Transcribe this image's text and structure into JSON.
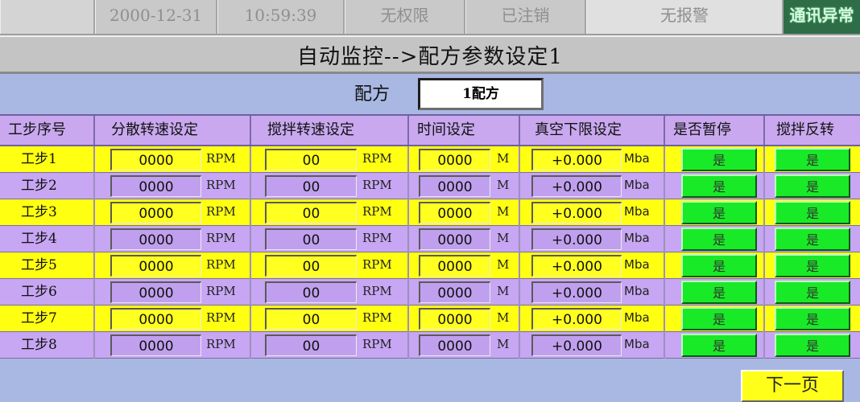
{
  "status": {
    "date": "2000-12-31",
    "time": "10:59:39",
    "permission": "无权限",
    "login": "已注销",
    "alarm": "无报警",
    "comm": "通讯异常"
  },
  "page_title": "自动监控-->配方参数设定1",
  "recipe": {
    "label": "配方",
    "value": "1配方"
  },
  "headers": [
    "工步序号",
    "分散转速设定",
    "搅拌转速设定",
    "时间设定",
    "真空下限设定",
    "是否暂停",
    "搅拌反转"
  ],
  "units": {
    "rpm": "RPM",
    "minute": "M",
    "vacuum": "Mba"
  },
  "rows": [
    {
      "step": "工步1",
      "disperse": "0000",
      "stir": "00",
      "time": "0000",
      "vacuum": "+0.000",
      "pause": "是",
      "reverse": "是"
    },
    {
      "step": "工步2",
      "disperse": "0000",
      "stir": "00",
      "time": "0000",
      "vacuum": "+0.000",
      "pause": "是",
      "reverse": "是"
    },
    {
      "step": "工步3",
      "disperse": "0000",
      "stir": "00",
      "time": "0000",
      "vacuum": "+0.000",
      "pause": "是",
      "reverse": "是"
    },
    {
      "step": "工步4",
      "disperse": "0000",
      "stir": "00",
      "time": "0000",
      "vacuum": "+0.000",
      "pause": "是",
      "reverse": "是"
    },
    {
      "step": "工步5",
      "disperse": "0000",
      "stir": "00",
      "time": "0000",
      "vacuum": "+0.000",
      "pause": "是",
      "reverse": "是"
    },
    {
      "step": "工步6",
      "disperse": "0000",
      "stir": "00",
      "time": "0000",
      "vacuum": "+0.000",
      "pause": "是",
      "reverse": "是"
    },
    {
      "step": "工步7",
      "disperse": "0000",
      "stir": "00",
      "time": "0000",
      "vacuum": "+0.000",
      "pause": "是",
      "reverse": "是"
    },
    {
      "step": "工步8",
      "disperse": "0000",
      "stir": "00",
      "time": "0000",
      "vacuum": "+0.000",
      "pause": "是",
      "reverse": "是"
    }
  ],
  "next_page": "下一页",
  "colors": {
    "row_yellow": "#ffff12",
    "row_purple": "#c7a6f3",
    "button_green": "#19ea27",
    "header_purple": "#c9a8ef"
  }
}
